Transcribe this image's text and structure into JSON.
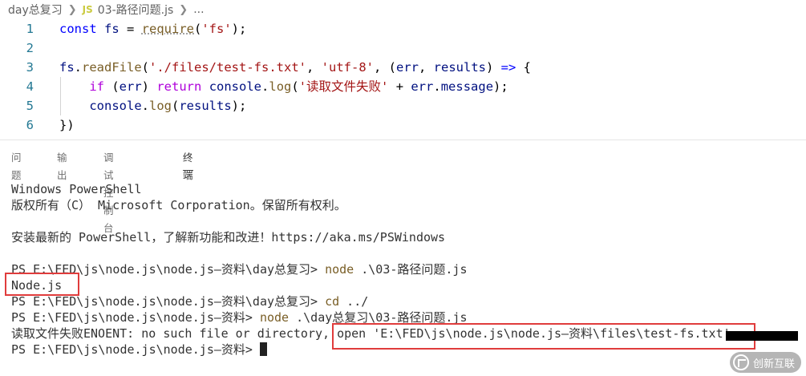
{
  "breadcrumb": {
    "folder": "day总复习",
    "lang_badge": "JS",
    "file": "03-路径问题.js",
    "more": "..."
  },
  "editor": {
    "lines": [
      {
        "num": "1",
        "tokens": [
          {
            "t": "const ",
            "c": "kw-blue"
          },
          {
            "t": "fs",
            "c": "var"
          },
          {
            "t": " = ",
            "c": "op"
          },
          {
            "t": "require",
            "c": "fn hover-dots"
          },
          {
            "t": "(",
            "c": "op"
          },
          {
            "t": "'fs'",
            "c": "str"
          },
          {
            "t": ");",
            "c": "op"
          }
        ]
      },
      {
        "num": "2",
        "tokens": []
      },
      {
        "num": "3",
        "tokens": [
          {
            "t": "fs",
            "c": "var"
          },
          {
            "t": ".",
            "c": "op"
          },
          {
            "t": "readFile",
            "c": "fn"
          },
          {
            "t": "(",
            "c": "op"
          },
          {
            "t": "'./files/test-fs.txt'",
            "c": "str"
          },
          {
            "t": ", ",
            "c": "op"
          },
          {
            "t": "'utf-8'",
            "c": "str"
          },
          {
            "t": ", (",
            "c": "op"
          },
          {
            "t": "err",
            "c": "var"
          },
          {
            "t": ", ",
            "c": "op"
          },
          {
            "t": "results",
            "c": "var"
          },
          {
            "t": ") ",
            "c": "op"
          },
          {
            "t": "=>",
            "c": "kw-blue"
          },
          {
            "t": " {",
            "c": "op"
          }
        ]
      },
      {
        "num": "4",
        "tokens": [
          {
            "t": "    ",
            "c": "op"
          },
          {
            "t": "if",
            "c": "kw-purple"
          },
          {
            "t": " (",
            "c": "op"
          },
          {
            "t": "err",
            "c": "var"
          },
          {
            "t": ") ",
            "c": "op"
          },
          {
            "t": "return",
            "c": "kw-purple"
          },
          {
            "t": " ",
            "c": "op"
          },
          {
            "t": "console",
            "c": "var"
          },
          {
            "t": ".",
            "c": "op"
          },
          {
            "t": "log",
            "c": "fn"
          },
          {
            "t": "(",
            "c": "op"
          },
          {
            "t": "'读取文件失败'",
            "c": "str"
          },
          {
            "t": " + ",
            "c": "op"
          },
          {
            "t": "err",
            "c": "var"
          },
          {
            "t": ".",
            "c": "op"
          },
          {
            "t": "message",
            "c": "var"
          },
          {
            "t": ");",
            "c": "op"
          }
        ]
      },
      {
        "num": "5",
        "tokens": [
          {
            "t": "    ",
            "c": "op"
          },
          {
            "t": "console",
            "c": "var"
          },
          {
            "t": ".",
            "c": "op"
          },
          {
            "t": "log",
            "c": "fn"
          },
          {
            "t": "(",
            "c": "op"
          },
          {
            "t": "results",
            "c": "var"
          },
          {
            "t": ");",
            "c": "op"
          }
        ]
      },
      {
        "num": "6",
        "tokens": [
          {
            "t": "})",
            "c": "op"
          }
        ]
      }
    ]
  },
  "panel": {
    "tabs": [
      {
        "label": "问题",
        "active": false
      },
      {
        "label": "输出",
        "active": false
      },
      {
        "label": "调试控制台",
        "active": false
      },
      {
        "label": "终端",
        "active": true
      }
    ]
  },
  "terminal": {
    "l1": "Windows PowerShell",
    "l2": "版权所有（C） Microsoft Corporation。保留所有权利。",
    "l3": "安装最新的 PowerShell，了解新功能和改进！https://aka.ms/PSWindows",
    "prompt1": "PS E:\\FED\\js\\node.js\\node.js—资料\\day总复习> ",
    "cmd1": "node",
    "arg1": " .\\03-路径问题.js",
    "out1": "Node.js",
    "prompt2": "PS E:\\FED\\js\\node.js\\node.js—资料\\day总复习> ",
    "cmd2": "cd",
    "arg2": " ../",
    "prompt3": "PS E:\\FED\\js\\node.js\\node.js—资料> ",
    "cmd3": "node",
    "arg3": " .\\day总复习\\03-路径问题.js",
    "err": "读取文件失败ENOENT: no such file or directory, open 'E:\\FED\\js\\node.js\\node.js—资料\\files\\test-fs.txt'",
    "prompt4": "PS E:\\FED\\js\\node.js\\node.js—资料> "
  },
  "watermark": {
    "text": "创新互联"
  },
  "colors": {
    "highlight_box": "#e03c3c",
    "line_number": "#237893",
    "keyword": "#0000ff",
    "control_keyword": "#af00db",
    "string": "#a31515",
    "function": "#795e26",
    "variable": "#001080"
  }
}
